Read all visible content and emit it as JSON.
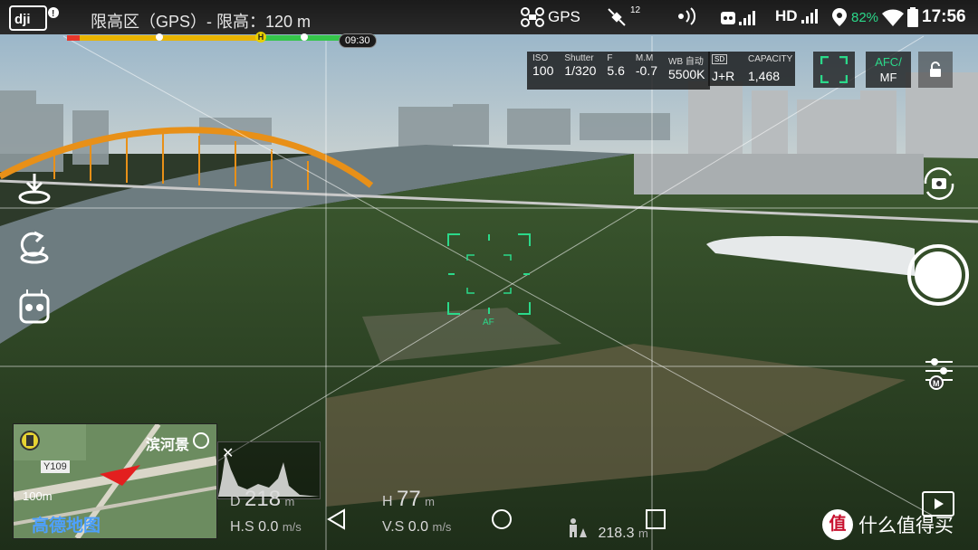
{
  "status_bar": {
    "fence_text": "限高区（GPS）- 限高：120 m",
    "gps_label": "GPS",
    "gps_sat_count": "12",
    "hd_label": "HD",
    "battery_percent": "82%",
    "clock": "17:56"
  },
  "flight_progress": {
    "time_chip": "09:30",
    "home_marker": "H"
  },
  "camera_params": {
    "iso_label": "ISO",
    "iso_value": "100",
    "shutter_label": "Shutter",
    "shutter_value": "1/320",
    "f_label": "F",
    "f_value": "5.6",
    "mm_label": "M.M",
    "mm_value": "-0.7",
    "wb_label": "WB 自动",
    "wb_value": "5500K",
    "sd_label": "SD",
    "format_value": "J+R",
    "capacity_label": "CAPACITY",
    "capacity_value": "1,468"
  },
  "focus_controls": {
    "afc_line1": "AFC/",
    "afc_line2": "MF",
    "af_label": "AF"
  },
  "map": {
    "road_label": "Y109",
    "place_label": "滨河景",
    "scale_label": "100m",
    "brand_label": "高德地图"
  },
  "telemetry": {
    "d_label": "D",
    "d_value": "218",
    "d_unit": "m",
    "h_label": "H",
    "h_value": "77",
    "h_unit": "m",
    "hs_label": "H.S",
    "hs_value": "0.0",
    "hs_unit": "m/s",
    "vs_label": "V.S",
    "vs_value": "0.0",
    "vs_unit": "m/s",
    "home_dist_value": "218.3",
    "home_dist_unit": "m"
  },
  "watermark": {
    "badge": "值",
    "text": "什么值得买"
  },
  "icons": [
    "dji-logo",
    "drone-icon",
    "satellite-icon",
    "signal-icon",
    "remote-icon",
    "location-icon",
    "wifi-icon",
    "battery-icon",
    "focus-frame-icon",
    "lock-icon",
    "camera-switch-icon",
    "takeoff-icon",
    "return-home-icon",
    "remote-controller-icon",
    "shutter-button",
    "settings-sliders-icon",
    "playback-icon",
    "back-icon",
    "home-icon",
    "recents-icon"
  ],
  "colors": {
    "accent_green": "#2bd98a",
    "progress_yellow": "#e9b400",
    "progress_green": "#35c54a",
    "progress_red": "#e7372b"
  }
}
